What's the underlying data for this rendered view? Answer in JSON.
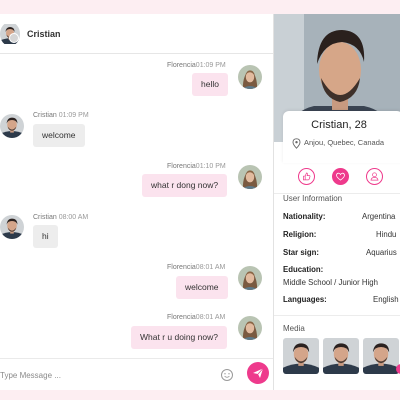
{
  "chat": {
    "contact_name": "Cristian",
    "messages": [
      {
        "sender": "Florencia",
        "time": "01:09 PM",
        "text": "hello",
        "direction": "out"
      },
      {
        "sender": "Cristian",
        "time": "01:09 PM",
        "text": "welcome",
        "direction": "in"
      },
      {
        "sender": "Florencia",
        "time": "01:10 PM",
        "text": "what r dong now?",
        "direction": "out"
      },
      {
        "sender": "Cristian",
        "time": "08:00 AM",
        "text": "hi",
        "direction": "in"
      },
      {
        "sender": "Florencia",
        "time": "08:01 AM",
        "text": "welcome",
        "direction": "out"
      },
      {
        "sender": "Florencia",
        "time": "08:01 AM",
        "text": "What r u doing now?",
        "direction": "out"
      }
    ],
    "composer": {
      "placeholder": "Type Message ...",
      "emoji_icon": "smiley-icon",
      "send_icon": "paper-plane-icon"
    }
  },
  "profile": {
    "name_age": "Cristian, 28",
    "location": "Anjou, Quebec, Canada",
    "actions": [
      {
        "icon": "thumbs-up-icon",
        "active": false
      },
      {
        "icon": "heart-icon",
        "active": true
      },
      {
        "icon": "user-icon",
        "active": false
      }
    ],
    "user_information": {
      "title": "User Information",
      "nationality_label": "Nationality:",
      "nationality_value": "Argentina",
      "religion_label": "Religion:",
      "religion_value": "Hindu",
      "star_sign_label": "Star sign:",
      "star_sign_value": "Aquarius",
      "education_label": "Education:",
      "education_value": "Middle School / Junior High",
      "languages_label": "Languages:",
      "languages_value": "English"
    },
    "media": {
      "title": "Media",
      "count": 3
    }
  },
  "colors": {
    "accent": "#ee3a8c",
    "bubble_out": "#fbe3ee",
    "bubble_in": "#ededed",
    "page_bg": "#fdeef2"
  }
}
